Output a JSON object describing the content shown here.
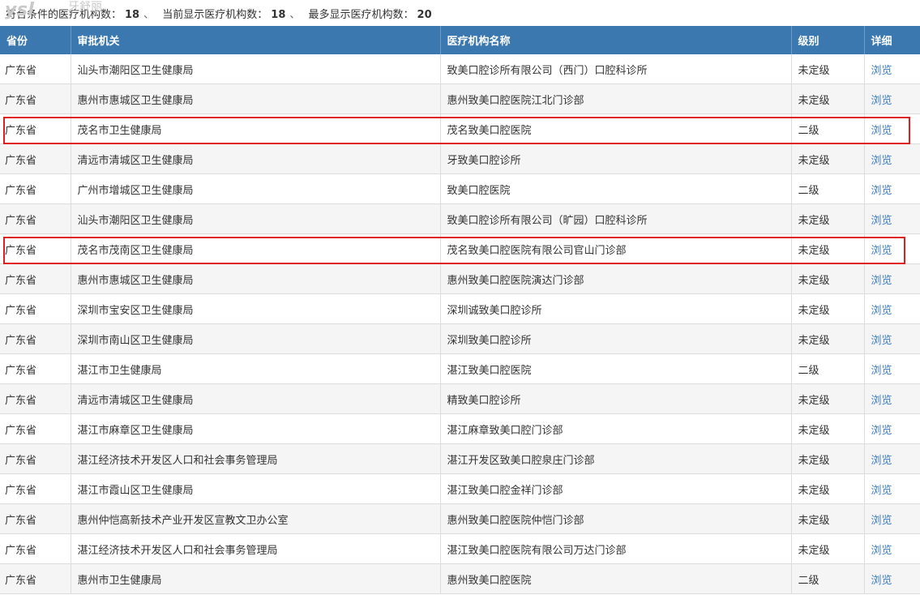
{
  "watermark": {
    "logo": "ysl",
    "text": "牙舒丽"
  },
  "summary": {
    "label1": "符合条件的医疗机构数：",
    "value1": "18",
    "sep1": "、",
    "label2": "当前显示医疗机构数：",
    "value2": "18",
    "sep2": "、",
    "label3": "最多显示医疗机构数：",
    "value3": "20"
  },
  "table": {
    "headers": [
      "省份",
      "审批机关",
      "医疗机构名称",
      "级别",
      "详细"
    ],
    "rows": [
      {
        "province": "广东省",
        "authority": "汕头市潮阳区卫生健康局",
        "name": "致美口腔诊所有限公司（西门）口腔科诊所",
        "level": "未定级",
        "link": "浏览"
      },
      {
        "province": "广东省",
        "authority": "惠州市惠城区卫生健康局",
        "name": "惠州致美口腔医院江北门诊部",
        "level": "未定级",
        "link": "浏览"
      },
      {
        "province": "广东省",
        "authority": "茂名市卫生健康局",
        "name": "茂名致美口腔医院",
        "level": "二级",
        "link": "浏览"
      },
      {
        "province": "广东省",
        "authority": "清远市清城区卫生健康局",
        "name": "牙致美口腔诊所",
        "level": "未定级",
        "link": "浏览"
      },
      {
        "province": "广东省",
        "authority": "广州市增城区卫生健康局",
        "name": "致美口腔医院",
        "level": "二级",
        "link": "浏览"
      },
      {
        "province": "广东省",
        "authority": "汕头市潮阳区卫生健康局",
        "name": "致美口腔诊所有限公司（旷园）口腔科诊所",
        "level": "未定级",
        "link": "浏览"
      },
      {
        "province": "广东省",
        "authority": "茂名市茂南区卫生健康局",
        "name": "茂名致美口腔医院有限公司官山门诊部",
        "level": "未定级",
        "link": "浏览"
      },
      {
        "province": "广东省",
        "authority": "惠州市惠城区卫生健康局",
        "name": "惠州致美口腔医院演达门诊部",
        "level": "未定级",
        "link": "浏览"
      },
      {
        "province": "广东省",
        "authority": "深圳市宝安区卫生健康局",
        "name": "深圳诚致美口腔诊所",
        "level": "未定级",
        "link": "浏览"
      },
      {
        "province": "广东省",
        "authority": "深圳市南山区卫生健康局",
        "name": "深圳致美口腔诊所",
        "level": "未定级",
        "link": "浏览"
      },
      {
        "province": "广东省",
        "authority": "湛江市卫生健康局",
        "name": "湛江致美口腔医院",
        "level": "二级",
        "link": "浏览"
      },
      {
        "province": "广东省",
        "authority": "清远市清城区卫生健康局",
        "name": "精致美口腔诊所",
        "level": "未定级",
        "link": "浏览"
      },
      {
        "province": "广东省",
        "authority": "湛江市麻章区卫生健康局",
        "name": "湛江麻章致美口腔门诊部",
        "level": "未定级",
        "link": "浏览"
      },
      {
        "province": "广东省",
        "authority": "湛江经济技术开发区人口和社会事务管理局",
        "name": "湛江开发区致美口腔泉庄门诊部",
        "level": "未定级",
        "link": "浏览"
      },
      {
        "province": "广东省",
        "authority": "湛江市霞山区卫生健康局",
        "name": "湛江致美口腔金祥门诊部",
        "level": "未定级",
        "link": "浏览"
      },
      {
        "province": "广东省",
        "authority": "惠州仲恺高新技术产业开发区宣教文卫办公室",
        "name": "惠州致美口腔医院仲恺门诊部",
        "level": "未定级",
        "link": "浏览"
      },
      {
        "province": "广东省",
        "authority": "湛江经济技术开发区人口和社会事务管理局",
        "name": "湛江致美口腔医院有限公司万达门诊部",
        "level": "未定级",
        "link": "浏览"
      },
      {
        "province": "广东省",
        "authority": "惠州市卫生健康局",
        "name": "惠州致美口腔医院",
        "level": "二级",
        "link": "浏览"
      }
    ]
  },
  "highlight_color": "#e02020",
  "header_color": "#3b78b0",
  "link_color": "#3b7cc4"
}
